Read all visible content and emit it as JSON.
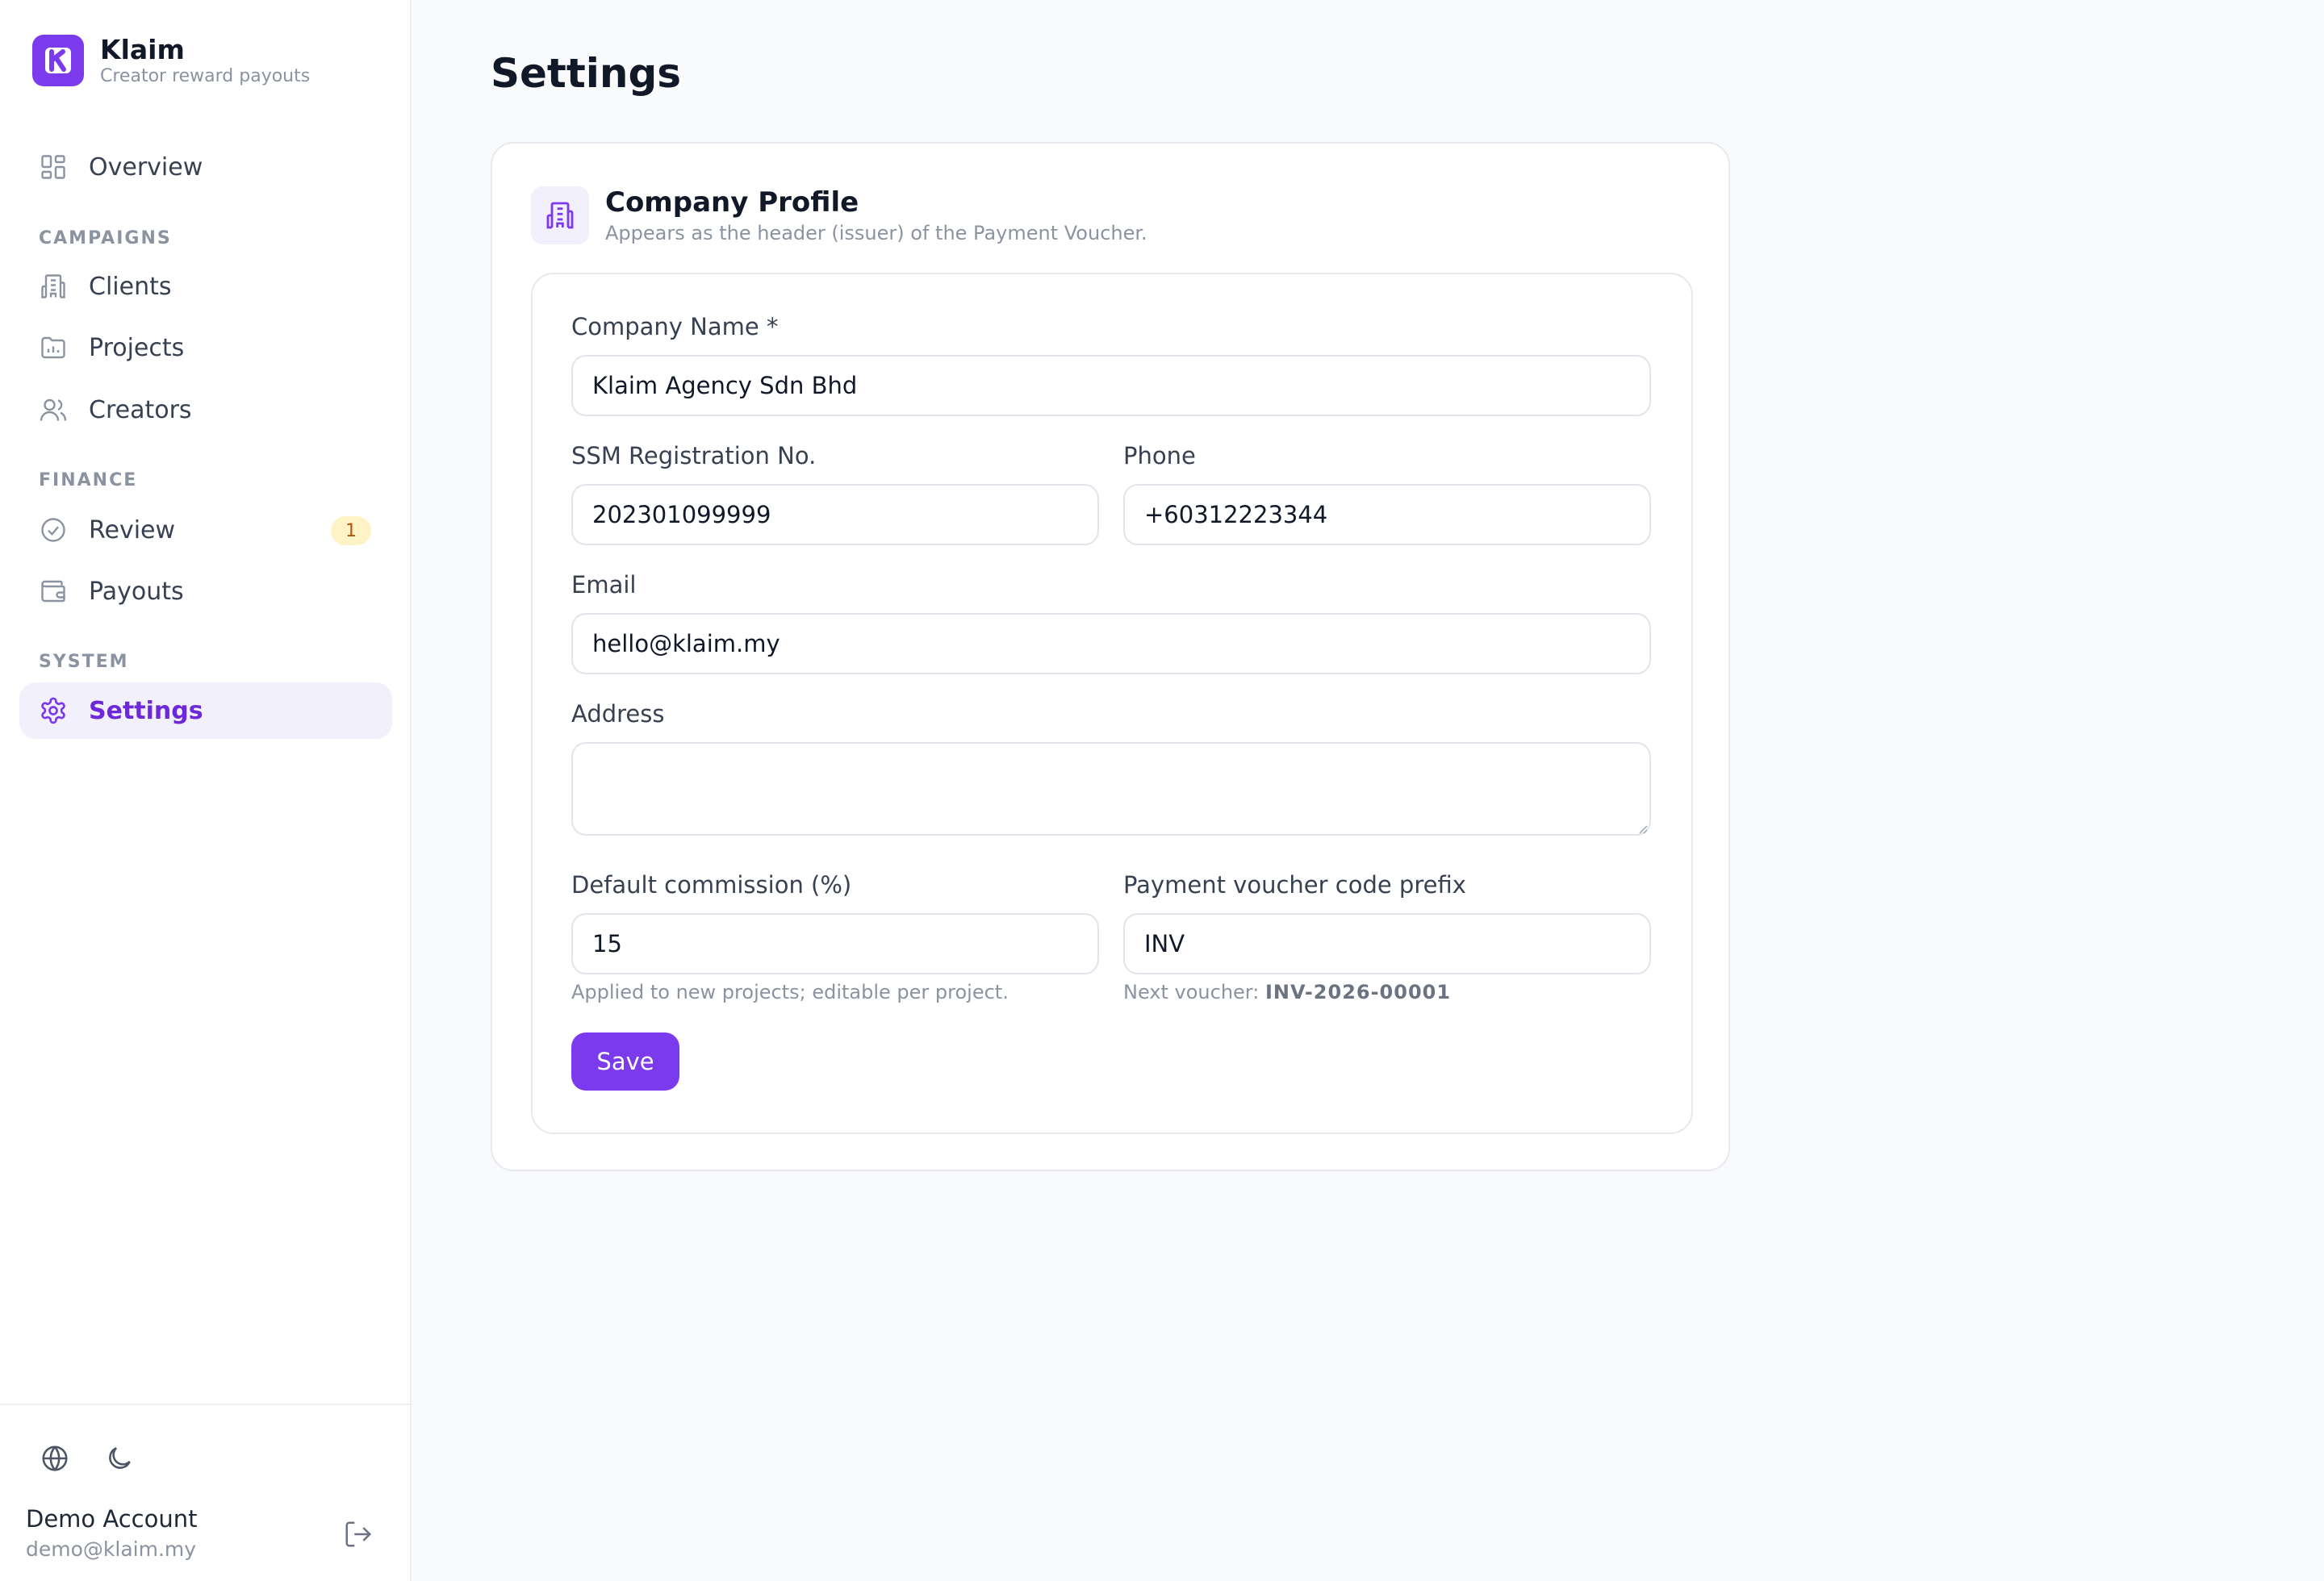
{
  "brand": {
    "name": "Klaim",
    "tagline": "Creator reward payouts",
    "logo_letter": "K"
  },
  "nav": {
    "overview": "Overview",
    "campaigns_title": "CAMPAIGNS",
    "clients": "Clients",
    "projects": "Projects",
    "creators": "Creators",
    "finance_title": "FINANCE",
    "review": "Review",
    "review_badge": "1",
    "payouts": "Payouts",
    "system_title": "SYSTEM",
    "settings": "Settings",
    "active": "settings"
  },
  "footer": {
    "language_icon": "globe-icon",
    "theme_icon": "moon-icon",
    "account_name": "Demo Account",
    "account_email": "demo@klaim.my",
    "logout_icon": "logout-icon"
  },
  "page": {
    "title": "Settings"
  },
  "company_profile": {
    "title": "Company Profile",
    "subtitle": "Appears as the header (issuer) of the Payment Voucher.",
    "fields": {
      "company_name": {
        "label": "Company Name *",
        "value": "Klaim Agency Sdn Bhd"
      },
      "ssm": {
        "label": "SSM Registration No.",
        "value": "202301099999"
      },
      "phone": {
        "label": "Phone",
        "value": "+60312223344"
      },
      "email": {
        "label": "Email",
        "value": "hello@klaim.my"
      },
      "address": {
        "label": "Address",
        "value": ""
      },
      "commission": {
        "label": "Default commission (%)",
        "value": "15",
        "hint": "Applied to new projects; editable per project."
      },
      "voucher_prefix": {
        "label": "Payment voucher code prefix",
        "value": "INV",
        "hint_prefix": "Next voucher:",
        "hint_code": "INV-2026-00001"
      }
    },
    "save_label": "Save"
  },
  "colors": {
    "accent": "#7c3aed",
    "accent_soft": "#f3f0fe",
    "badge_bg": "#fef3c7",
    "badge_text": "#b45309",
    "muted_text": "#8b93a1",
    "background": "#f9fafb"
  }
}
